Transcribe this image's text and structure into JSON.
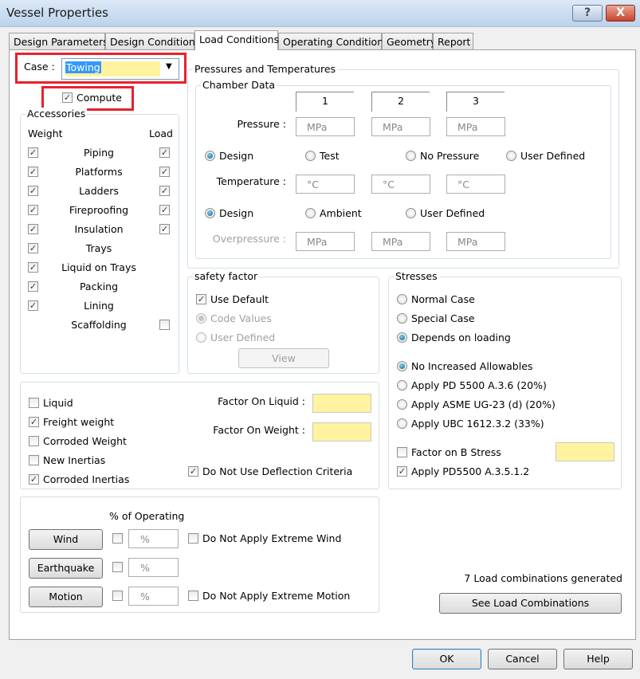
{
  "window": {
    "title": "Vessel Properties",
    "help_icon": "?",
    "close_icon": "X"
  },
  "tabs": [
    "Design Parameters",
    "Design Conditions",
    "Load Conditions",
    "Operating Conditions",
    "Geometry",
    "Report"
  ],
  "case": {
    "label": "Case :",
    "value": "Towing"
  },
  "compute": {
    "label": "Compute",
    "checked": true
  },
  "accessories": {
    "title": "Accessories",
    "weight_header": "Weight",
    "load_header": "Load",
    "items": [
      {
        "label": "Piping",
        "weight": true,
        "load": true
      },
      {
        "label": "Platforms",
        "weight": true,
        "load": true
      },
      {
        "label": "Ladders",
        "weight": true,
        "load": true
      },
      {
        "label": "Fireproofing",
        "weight": true,
        "load": true
      },
      {
        "label": "Insulation",
        "weight": true,
        "load": true
      },
      {
        "label": "Trays",
        "weight": true,
        "load": null
      },
      {
        "label": "Liquid on Trays",
        "weight": true,
        "load": null
      },
      {
        "label": "Packing",
        "weight": true,
        "load": null
      },
      {
        "label": "Lining",
        "weight": true,
        "load": null
      },
      {
        "label": "Scaffolding",
        "weight": null,
        "load": false
      }
    ]
  },
  "pt": {
    "title": "Pressures and Temperatures",
    "chamber_title": "Chamber Data",
    "columns": [
      "1",
      "2",
      "3"
    ],
    "pressure_label": "Pressure :",
    "pressure_unit": "MPa",
    "pressure_options": [
      "Design",
      "Test",
      "No Pressure",
      "User Defined"
    ],
    "temperature_label": "Temperature :",
    "temperature_unit": "°C",
    "temperature_options": [
      "Design",
      "Ambient",
      "User Defined"
    ],
    "overpressure_label": "Overpressure :",
    "overpressure_unit": "MPa"
  },
  "safety": {
    "title": "safety factor",
    "use_default": "Use Default",
    "code_values": "Code Values",
    "user_defined": "User Defined",
    "view": "View"
  },
  "stresses": {
    "title": "Stresses",
    "case_options": [
      "Normal Case",
      "Special Case",
      "Depends on loading"
    ],
    "allow_options": [
      "No Increased Allowables",
      "Apply PD 5500 A.3.6 (20%)",
      "Apply ASME UG-23 (d) (20%)",
      "Apply UBC 1612.3.2 (33%)"
    ],
    "factor_b": "Factor on B Stress",
    "apply_pd": "Apply PD5500 A.3.5.1.2"
  },
  "options": {
    "liquid": "Liquid",
    "freight": "Freight weight",
    "corroded_weight": "Corroded Weight",
    "new_inertias": "New Inertias",
    "corroded_inertias": "Corroded Inertias",
    "factor_liquid": "Factor On Liquid :",
    "factor_weight": "Factor On Weight :",
    "deflection": "Do Not Use Deflection Criteria"
  },
  "env": {
    "pct_header": "% of Operating",
    "wind": "Wind",
    "earthquake": "Earthquake",
    "motion": "Motion",
    "pct": "%",
    "extreme_wind": "Do Not Apply Extreme Wind",
    "extreme_motion": "Do Not Apply Extreme Motion"
  },
  "combos": {
    "status": "7 Load combinations generated",
    "button": "See Load Combinations"
  },
  "footer": {
    "ok": "OK",
    "cancel": "Cancel",
    "help": "Help"
  }
}
